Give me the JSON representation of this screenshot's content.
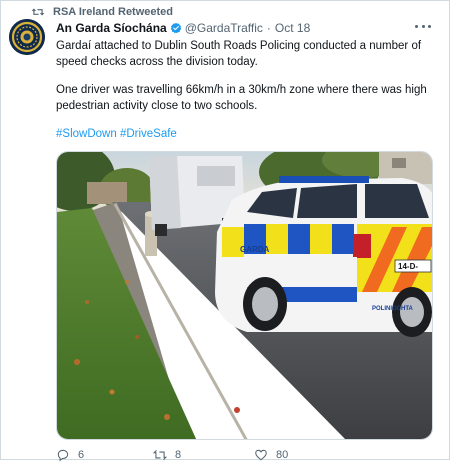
{
  "retweet": {
    "label": "RSA Ireland Retweeted"
  },
  "tweet": {
    "author_name": "An Garda Síochána",
    "handle": "@GardaTraffic",
    "separator": "·",
    "date": "Oct 18",
    "paragraph1": "Gardaí attached to Dublin South Roads Policing conducted a number of speed checks across the division today.",
    "paragraph2": "One driver was travelling 66km/h in a 30km/h zone where there was high pedestrian activity close to two schools.",
    "hashtags": [
      "#SlowDown",
      "#DriveSafe"
    ]
  },
  "photo": {
    "car_text_left": "GARDA",
    "plate": "14-D-",
    "car_text_right": "POLINIOCHTA"
  },
  "actions": {
    "replies": "6",
    "retweets": "8",
    "likes": "80"
  },
  "colors": {
    "link": "#1d9bf0",
    "muted": "#536471",
    "text": "#0f1419",
    "border": "#cfd9de"
  },
  "icons": [
    "retweet-icon",
    "verified-icon",
    "more-icon",
    "reply-icon",
    "like-icon"
  ]
}
